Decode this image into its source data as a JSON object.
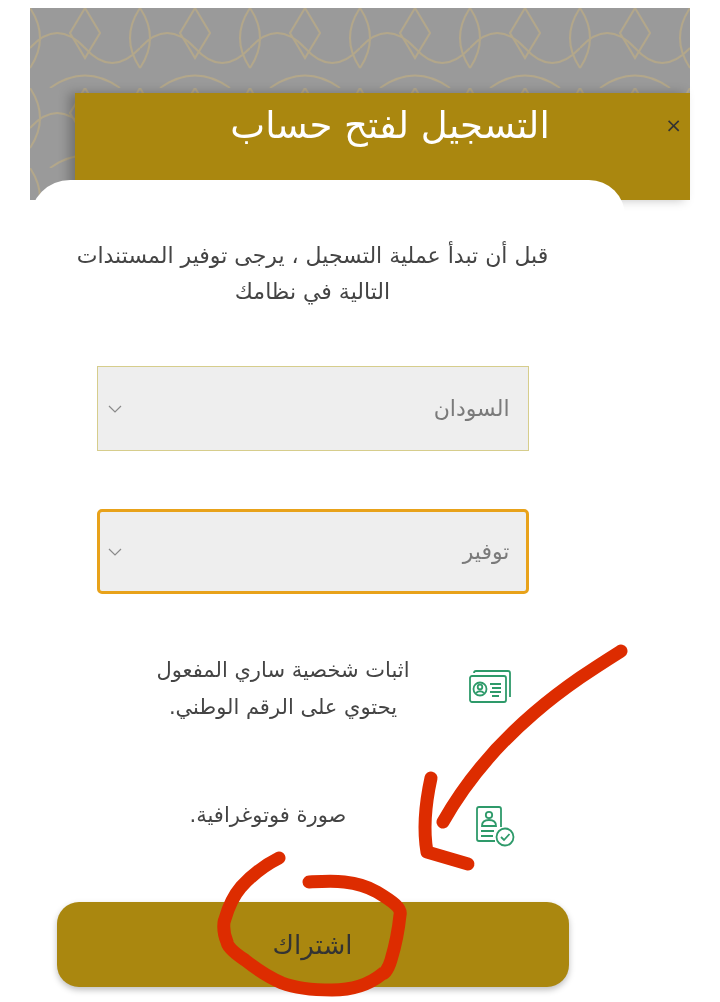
{
  "dialog": {
    "title": "التسجيل لفتح حساب",
    "close": "×"
  },
  "intro": "قبل أن تبدأ عملية التسجيل ، يرجى توفير المستندات التالية في نظامك",
  "selects": [
    {
      "value": "السودان",
      "focused": false
    },
    {
      "value": "توفير",
      "focused": true
    }
  ],
  "requirements": [
    {
      "kind": "id_card",
      "text": "اثبات شخصية ساري المفعول يحتوي على الرقم الوطني."
    },
    {
      "kind": "photo",
      "text": "صورة فوتوغرافية."
    }
  ],
  "submit": "اشتراك"
}
